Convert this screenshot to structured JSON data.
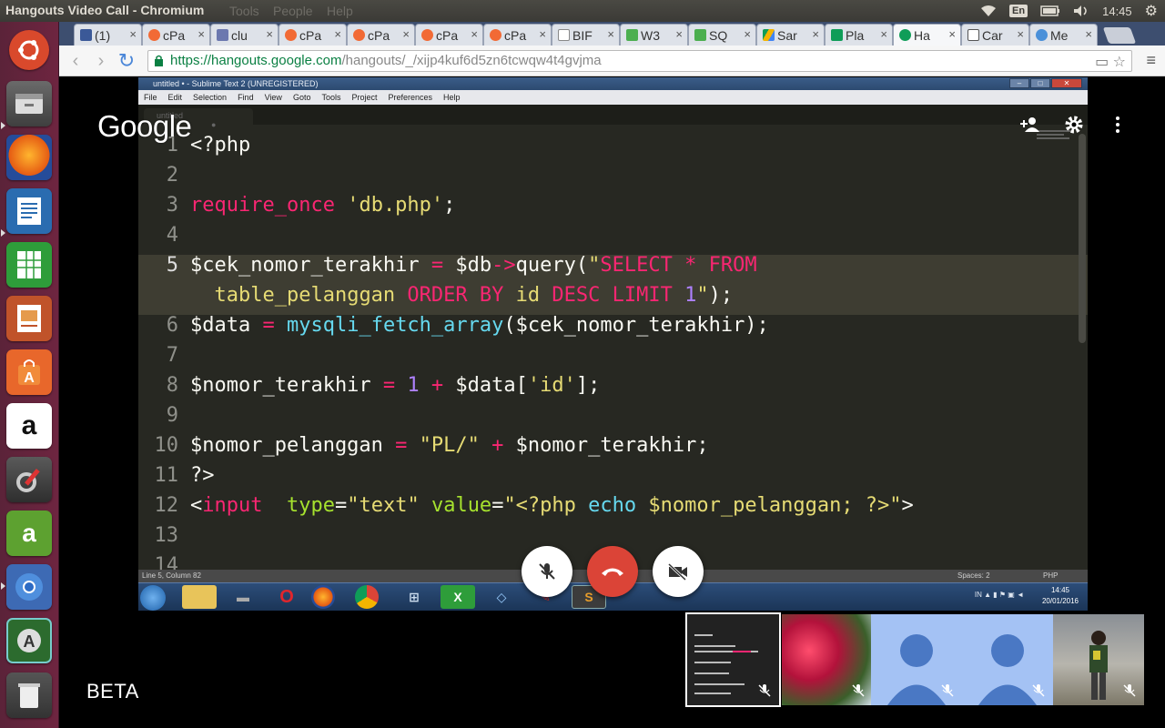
{
  "os_topbar": {
    "window_title": "Hangouts Video Call - Chromium",
    "menus": [
      "Tools",
      "People",
      "Help"
    ],
    "lang": "En",
    "clock": "14:45"
  },
  "tabs": [
    {
      "title": "(1)",
      "favicon": "facebook-icon",
      "color": "#3b5998"
    },
    {
      "title": "cPa",
      "favicon": "cpanel-icon",
      "color": "#f26a35"
    },
    {
      "title": "clu",
      "favicon": "phpmyadmin-icon",
      "color": "#6c78af"
    },
    {
      "title": "cPa",
      "favicon": "cpanel-icon",
      "color": "#f26a35"
    },
    {
      "title": "cPa",
      "favicon": "cpanel-icon",
      "color": "#f26a35"
    },
    {
      "title": "cPa",
      "favicon": "cpanel-icon",
      "color": "#f26a35"
    },
    {
      "title": "cPa",
      "favicon": "cpanel-icon",
      "color": "#f26a35"
    },
    {
      "title": "BIF",
      "favicon": "document-icon",
      "color": "#888888"
    },
    {
      "title": "W3",
      "favicon": "w3schools-icon",
      "color": "#4caf50"
    },
    {
      "title": "SQ",
      "favicon": "w3schools-icon",
      "color": "#4caf50"
    },
    {
      "title": "Sar",
      "favicon": "drive-icon",
      "color": "#f4b400"
    },
    {
      "title": "Pla",
      "favicon": "sheets-icon",
      "color": "#0f9d58"
    },
    {
      "title": "Ha",
      "favicon": "hangouts-icon",
      "color": "#0f9d58"
    },
    {
      "title": "Car",
      "favicon": "document-icon",
      "color": "#555555"
    },
    {
      "title": "Me",
      "favicon": "messenger-icon",
      "color": "#4a90d9"
    }
  ],
  "address": {
    "host": "https://hangouts.google.com",
    "path": "/hangouts/_/xijp4kuf6d5zn6tcwqw4t4gvjma"
  },
  "sublime": {
    "title": "untitled • - Sublime Text 2 (UNREGISTERED)",
    "menus": [
      "File",
      "Edit",
      "Selection",
      "Find",
      "View",
      "Goto",
      "Tools",
      "Project",
      "Preferences",
      "Help"
    ],
    "tab": "untitled",
    "status_left": "Line 5, Column 82",
    "status_spaces": "Spaces: 2",
    "status_syntax": "PHP",
    "line_numbers": [
      "1",
      "2",
      "3",
      "4",
      "5",
      "6",
      "7",
      "8",
      "9",
      "10",
      "11",
      "12",
      "13",
      "14"
    ],
    "taskbar_tray": "IN",
    "taskbar_time": "14:45",
    "taskbar_date": "20/01/2016"
  },
  "hangout": {
    "logo": "Google",
    "beta": "BETA"
  }
}
